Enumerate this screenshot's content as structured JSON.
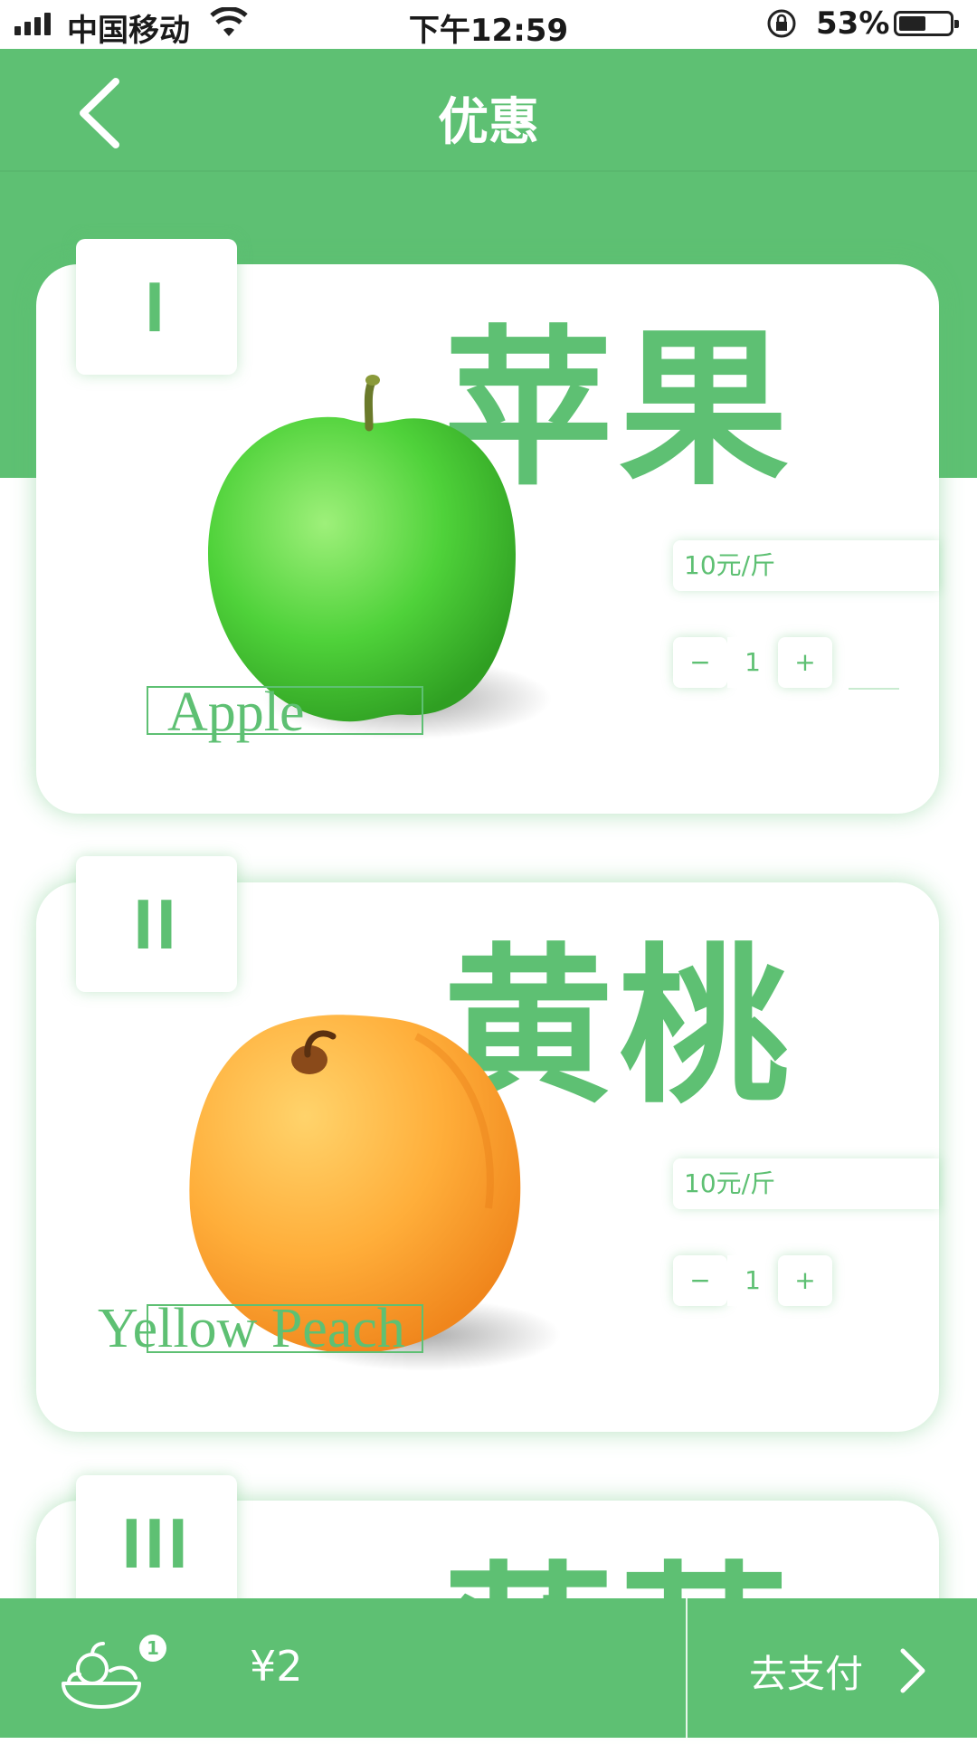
{
  "status_bar": {
    "carrier": "中国移动",
    "time": "下午12:59",
    "battery_pct": "53%",
    "battery_level": 0.53,
    "icons": [
      "signal-icon",
      "wifi-icon",
      "rotation-lock-icon",
      "battery-icon"
    ]
  },
  "nav": {
    "title": "优惠",
    "back_icon": "chevron-left-icon"
  },
  "colors": {
    "brand_green": "#5ec073",
    "background": "#ffffff"
  },
  "products": [
    {
      "numeral": "I",
      "name": "苹果",
      "english": "Apple",
      "price": "10元/斤",
      "quantity": "1",
      "minus": "−",
      "plus": "+",
      "image": "green-apple-image"
    },
    {
      "numeral": "II",
      "name": "黄桃",
      "english": "Yellow Peach",
      "price": "10元/斤",
      "quantity": "1",
      "minus": "−",
      "plus": "+",
      "image": "yellow-peach-image"
    },
    {
      "numeral": "III",
      "name": "菠萝",
      "image": "partially-hidden"
    }
  ],
  "bottom_bar": {
    "cart_count": "1",
    "total": "¥2",
    "pay_label": "去支付",
    "cart_icon": "fruit-basket-icon",
    "pay_icon": "chevron-right-icon"
  }
}
